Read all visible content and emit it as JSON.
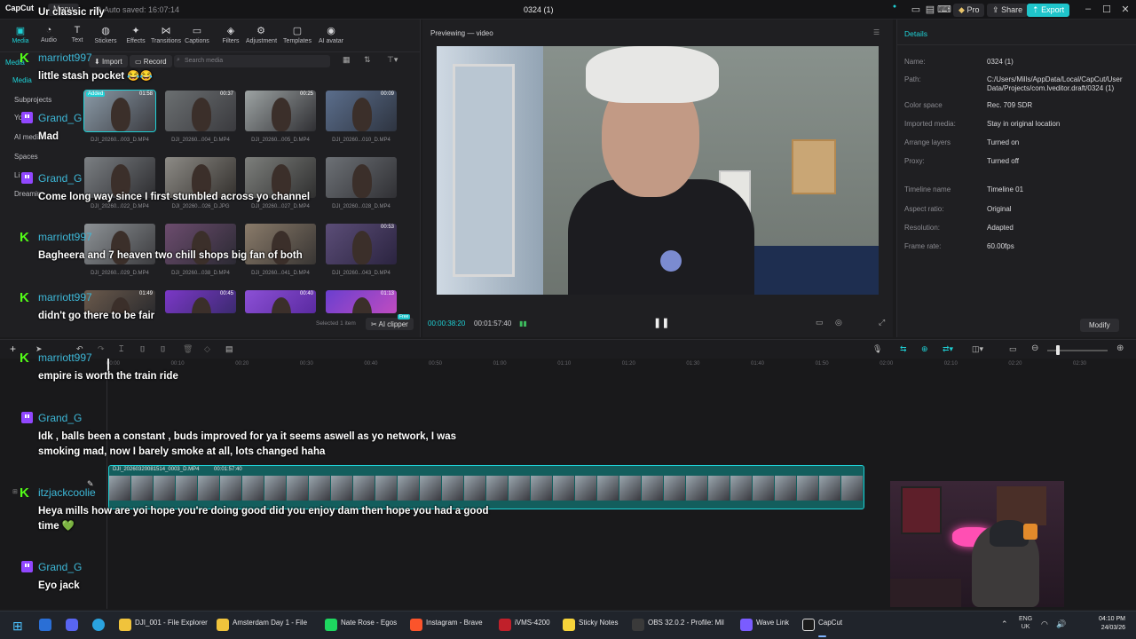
{
  "titlebar": {
    "app_name": "CapCut",
    "menu_label": "Menu",
    "autosave": "Auto saved: 16:07:14",
    "project_title": "0324 (1)",
    "pro_label": "Pro",
    "share_label": "Share",
    "export_label": "Export"
  },
  "toolbar": {
    "tools": [
      "Media",
      "Audio",
      "Text",
      "Stickers",
      "Effects",
      "Transitions",
      "Captions",
      "Filters",
      "Adjustment",
      "Templates",
      "AI avatar"
    ]
  },
  "media": {
    "sidebar": [
      "Media",
      "Subprojects",
      "Yo",
      "AI media",
      "Spaces",
      "Li",
      "Dreamin"
    ],
    "import_label": "Import",
    "record_label": "Record",
    "search_placeholder": "Search media",
    "selected_info": "Selected 1 item",
    "ai_clipper_label": "AI clipper",
    "free_badge": "Free",
    "added_badge": "Added",
    "items": [
      {
        "name": "DJI_20260...003_D.MP4",
        "duration": "01:58"
      },
      {
        "name": "DJI_20260...004_D.MP4",
        "duration": "00:37"
      },
      {
        "name": "DJI_20260...005_D.MP4",
        "duration": "00:25"
      },
      {
        "name": "DJI_20260...010_D.MP4",
        "duration": "00:09"
      },
      {
        "name": "DJI_20260...022_D.MP4",
        "duration": ""
      },
      {
        "name": "DJI_20260...026_D.JPG",
        "duration": ""
      },
      {
        "name": "DJI_20260...027_D.MP4",
        "duration": ""
      },
      {
        "name": "DJI_20260...028_D.MP4",
        "duration": ""
      },
      {
        "name": "DJI_20260...029_D.MP4",
        "duration": ""
      },
      {
        "name": "DJI_20260...038_D.MP4",
        "duration": ""
      },
      {
        "name": "DJI_20260...041_D.MP4",
        "duration": ""
      },
      {
        "name": "DJI_20260...043_D.MP4",
        "duration": "00:53"
      },
      {
        "name": "",
        "duration": "01:49"
      },
      {
        "name": "",
        "duration": "00:45"
      },
      {
        "name": "",
        "duration": "00:40"
      },
      {
        "name": "",
        "duration": "01:13"
      }
    ]
  },
  "preview": {
    "title": "Previewing — video",
    "current_time": "00:00:38:20",
    "total_time": "00:01:57:40"
  },
  "details": {
    "header": "Details",
    "rows": [
      {
        "label": "Name:",
        "value": "0324 (1)"
      },
      {
        "label": "Path:",
        "value": "C:/Users/Mills/AppData/Local/CapCut/User Data/Projects/com.lveditor.draft/0324 (1)"
      },
      {
        "label": "Color space",
        "value": "Rec. 709 SDR"
      },
      {
        "label": "Imported media:",
        "value": "Stay in original location"
      },
      {
        "label": "Arrange layers",
        "value": "Turned on"
      },
      {
        "label": "Proxy:",
        "value": "Turned off"
      },
      {
        "label": "Timeline name",
        "value": "Timeline 01"
      },
      {
        "label": "Aspect ratio:",
        "value": "Original"
      },
      {
        "label": "Resolution:",
        "value": "Adapted"
      },
      {
        "label": "Frame rate:",
        "value": "60.00fps"
      }
    ],
    "modify_label": "Modify"
  },
  "timeline": {
    "ticks": [
      "00:00",
      "00:10",
      "00:20",
      "00:30",
      "00:40",
      "00:50",
      "01:00",
      "01:10",
      "01:20",
      "01:30",
      "01:40",
      "01:50",
      "02:00",
      "02:10",
      "02:20",
      "02:30"
    ],
    "clip_name": "DJI_20260320081514_0003_D.MP4",
    "clip_duration": "00:01:57:40"
  },
  "chat": [
    {
      "platform": "kick",
      "user": "",
      "message": "Ur classic rily"
    },
    {
      "platform": "kick",
      "user": "marriott997",
      "message": "little stash pocket 😂😂"
    },
    {
      "platform": "twitch",
      "user": "Grand_G",
      "message": "Mad"
    },
    {
      "platform": "twitch",
      "user": "Grand_G",
      "message": "Come long way since I first stumbled across yo channel"
    },
    {
      "platform": "kick",
      "user": "marriott997",
      "message": "Bagheera and 7 heaven two chill shops big fan of both"
    },
    {
      "platform": "kick",
      "user": "marriott997",
      "message": "didn't go there to be fair"
    },
    {
      "platform": "kick",
      "user": "marriott997",
      "message": "empire is worth the train ride"
    },
    {
      "platform": "twitch",
      "user": "Grand_G",
      "message": "Idk , balls been a constant , buds improved for ya it seems aswell as yo network, I was smoking mad, now I barely smoke at all, lots changed haha"
    },
    {
      "platform": "kick",
      "user": "itzjackcoolie",
      "message": "Heya mills how are yoi hope you're doing good did you enjoy dam then hope you had a good time 💚"
    },
    {
      "platform": "twitch",
      "user": "Grand_G",
      "message": "Eyo jack"
    }
  ],
  "taskbar": {
    "apps": [
      "DJI_001 - File Explorer",
      "Amsterdam Day 1 - File",
      "Nate Rose - Egos",
      "Instagram - Brave",
      "iVMS-4200",
      "Sticky Notes",
      "OBS 32.0.2 - Profile: Mil",
      "Wave Link",
      "CapCut"
    ],
    "lang": "ENG",
    "region": "UK",
    "time": "04:10 PM",
    "date": "24/03/26"
  },
  "colors": {
    "accent": "#1fd1d6",
    "kick": "#53fc18",
    "twitch": "#9147ff",
    "chat_name": "#3db8d8"
  }
}
